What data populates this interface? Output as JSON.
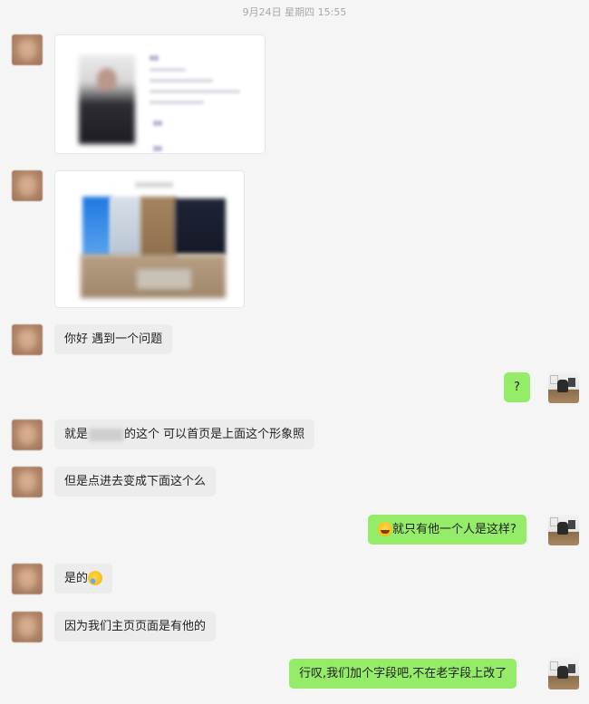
{
  "window": {
    "timestamp": "9月24日 星期四 15:55"
  },
  "messages": [
    {
      "side": "in",
      "kind": "image",
      "description": "blurred-profile-card-image"
    },
    {
      "side": "in",
      "kind": "image",
      "description": "blurred-office-photo-image"
    },
    {
      "side": "in",
      "kind": "text",
      "text": "你好 遇到一个问题"
    },
    {
      "side": "out",
      "kind": "text",
      "text": "?"
    },
    {
      "side": "in",
      "kind": "text",
      "text_before": "就是",
      "text_after": "的这个 可以首页是上面这个形象照"
    },
    {
      "side": "in",
      "kind": "text",
      "text": "但是点进去变成下面这个么"
    },
    {
      "side": "out",
      "kind": "text",
      "emoji": "laugh-emoji",
      "text": "就只有他一个人是这样?"
    },
    {
      "side": "in",
      "kind": "text",
      "text": "是的",
      "emoji": "crying-laugh-emoji"
    },
    {
      "side": "in",
      "kind": "text",
      "text": "因为我们主页页面是有他的"
    },
    {
      "side": "out",
      "kind": "text",
      "text": "行叹,我们加个字段吧,不在老字段上改了"
    }
  ],
  "colors": {
    "background": "#f5f5f5",
    "incoming_bubble": "#ececec",
    "outgoing_bubble": "#95ec69",
    "timestamp_text": "#a8a8a8"
  }
}
